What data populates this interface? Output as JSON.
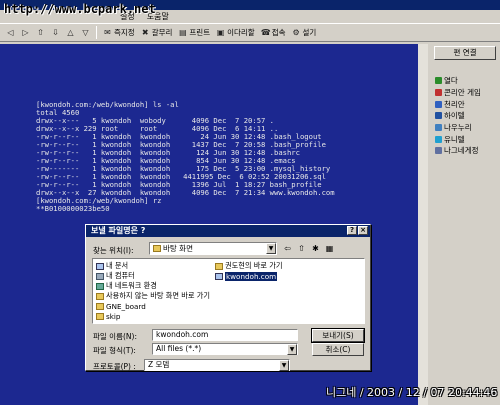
{
  "watermark_top": "http://www.bcpark.net",
  "watermark_bottom": "니그네 / 2003 / 12 / 07  20:44:46",
  "menu": [
    "설정",
    "도움말"
  ],
  "toolbar": {
    "items": [
      {
        "icon": "back-arrow-icon",
        "label": ""
      },
      {
        "icon": "forward-arrow-icon",
        "label": ""
      },
      {
        "icon": "upload-icon",
        "label": ""
      },
      {
        "icon": "download-icon",
        "label": ""
      },
      {
        "icon": "up-arrow-icon",
        "label": ""
      },
      {
        "icon": "down-arrow-icon",
        "label": ""
      },
      {
        "icon": "fax-icon",
        "label": "즉지정"
      },
      {
        "icon": "close-icon",
        "label": "갈무리"
      },
      {
        "icon": "print-icon",
        "label": "프린트"
      },
      {
        "icon": "web-icon",
        "label": "이다리할"
      },
      {
        "icon": "connect-icon",
        "label": "접속"
      },
      {
        "icon": "settings-icon",
        "label": "설기"
      }
    ]
  },
  "terminal": {
    "lines": [
      "[kwondoh.com:/web/kwondoh] ls -al",
      "total 4560",
      "drwx--x---   5 kwondoh  wobody      4096 Dec  7 20:57 .",
      "drwx--x--x 229 root     root        4096 Dec  6 14:11 ..",
      "-rw-r--r--   1 kwondoh  kwondoh       24 Jun 30 12:48 .bash_logout",
      "-rw-r--r--   1 kwondoh  kwondoh     1437 Dec  7 20:58 .bash_profile",
      "-rw-r--r--   1 kwondoh  kwondoh      124 Jun 30 12:48 .bashrc",
      "-rw-r--r--   1 kwondoh  kwondoh      854 Jun 30 12:48 .emacs",
      "-rw-------   1 kwondoh  kwondoh      175 Dec  5 23:00 .mysql_history",
      "-rw-r--r--   1 kwondoh  kwondoh   4411995 Dec  6 02:52 20031206.sql",
      "-rw-r--r--   1 kwondoh  kwondoh     1396 Jul  1 18:27 bash_profile",
      "drwx--x--x  27 kwondoh  kwondoh     4096 Dec  7 21:34 www.kwondoh.com",
      "[kwondoh.com:/web/kwondoh] rz",
      "**B0100000023be50"
    ]
  },
  "sidepanel": {
    "button": "편 연결",
    "top_label": "",
    "items": [
      {
        "label": "열다",
        "color": "#2a8c2a"
      },
      {
        "label": "콘리안 게임",
        "color": "#c03030"
      },
      {
        "label": "천리안",
        "color": "#3060c0"
      },
      {
        "label": "하이텔",
        "color": "#2050a0"
      },
      {
        "label": "나우누리",
        "color": "#4080c0"
      },
      {
        "label": "유니텔",
        "color": "#20a0d0"
      },
      {
        "label": "나그네게정",
        "color": "#6070a0"
      }
    ]
  },
  "dialog": {
    "title": "보낼 파일명은 ?",
    "help": "?",
    "close": "×",
    "look_in_label": "찾는 위치(I):",
    "look_in_value": "바탕 화면",
    "files_col1": [
      {
        "name": "내 문서",
        "type": "doc"
      },
      {
        "name": "내 컴퓨터",
        "type": "pc"
      },
      {
        "name": "내 네트워크 환경",
        "type": "net"
      },
      {
        "name": "사용하지 않는 바탕 화면 바로 가기",
        "type": "folder"
      },
      {
        "name": "GNE_board",
        "type": "folder"
      },
      {
        "name": "skip",
        "type": "folder"
      }
    ],
    "files_col2": [
      {
        "name": "권도현의 바로 가기",
        "type": "folder",
        "selected": false
      },
      {
        "name": "kwondoh.com",
        "type": "doc",
        "selected": true
      }
    ],
    "filename_label": "파일 이름(N):",
    "filename_value": "kwondoh.com",
    "filetype_label": "파일 형식(T):",
    "filetype_value": "All files (*.*)",
    "protocol_label": "프로토콜(P) :",
    "protocol_value": "Z 모뎀",
    "open_button": "보내기(S)",
    "cancel_button": "취소(C)"
  }
}
